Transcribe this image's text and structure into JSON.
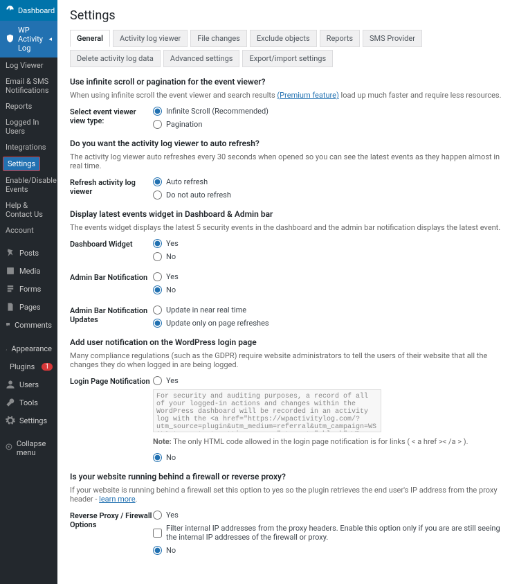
{
  "sidebar": {
    "dashboard": "Dashboard",
    "plugin": "WP Activity Log",
    "sub": [
      "Log Viewer",
      "Email & SMS Notifications",
      "Reports",
      "Logged In Users",
      "Integrations",
      "Settings",
      "Enable/Disable Events",
      "Help & Contact Us",
      "Account"
    ],
    "menu": [
      {
        "id": "posts",
        "label": "Posts",
        "icon": "pin"
      },
      {
        "id": "media",
        "label": "Media",
        "icon": "media"
      },
      {
        "id": "forms",
        "label": "Forms",
        "icon": "forms"
      },
      {
        "id": "pages",
        "label": "Pages",
        "icon": "page"
      },
      {
        "id": "comments",
        "label": "Comments",
        "icon": "comment"
      },
      {
        "id": "appearance",
        "label": "Appearance",
        "icon": "brush"
      },
      {
        "id": "plugins",
        "label": "Plugins",
        "icon": "plug",
        "badge": "1"
      },
      {
        "id": "users",
        "label": "Users",
        "icon": "user"
      },
      {
        "id": "tools",
        "label": "Tools",
        "icon": "tool"
      },
      {
        "id": "settings",
        "label": "Settings",
        "icon": "gear"
      }
    ],
    "collapse": "Collapse menu"
  },
  "page": {
    "title": "Settings",
    "tabs": [
      "General",
      "Activity log viewer",
      "File changes",
      "Exclude objects",
      "Reports",
      "SMS Provider",
      "Delete activity log data",
      "Advanced settings",
      "Export/import settings"
    ],
    "s1": {
      "h": "Use infinite scroll or pagination for the event viewer?",
      "d1": "When using infinite scroll the event viewer and search results ",
      "d_link": "(Premium feature)",
      "d2": " load up much faster and require less resources.",
      "lbl": "Select event viewer view type:",
      "o1": "Infinite Scroll (Recommended)",
      "o2": "Pagination"
    },
    "s2": {
      "h": "Do you want the activity log viewer to auto refresh?",
      "d": "The activity log viewer auto refreshes every 30 seconds when opened so you can see the latest events as they happen almost in real time.",
      "lbl": "Refresh activity log viewer",
      "o1": "Auto refresh",
      "o2": "Do not auto refresh"
    },
    "s3": {
      "h": "Display latest events widget in Dashboard & Admin bar",
      "d": "The events widget displays the latest 5 security events in the dashboard and the admin bar notification displays the latest event.",
      "lbl1": "Dashboard Widget",
      "lbl2": "Admin Bar Notification",
      "lbl3": "Admin Bar Notification Updates",
      "yes": "Yes",
      "no": "No",
      "u1": "Update in near real time",
      "u2": "Update only on page refreshes"
    },
    "s4": {
      "h": "Add user notification on the WordPress login page",
      "d": "Many compliance regulations (such as the GDPR) require website administrators to tell the users of their website that all the changes they do when logged in are being logged.",
      "lbl": "Login Page Notification",
      "txt": "For security and auditing purposes, a record of all of your logged-in actions and changes within the WordPress dashboard will be recorded in an activity log with the <a href=\"https://wpactivitylog.com/?utm_source=plugin&utm_medium=referral&utm_campaign=WSAL&utm_content=settings+pages\" target=\"_blank\">WP Activity Log",
      "note_pre": "Note:",
      "note": " The only HTML code allowed in the login page notification is for links ( < a href >< /a > )."
    },
    "s5": {
      "h": "Is your website running behind a firewall or reverse proxy?",
      "d": "If your website is running behind a firewall set this option to yes so the plugin retrieves the end user's IP address from the proxy header - ",
      "d_link": "learn more",
      "lbl": "Reverse Proxy / Firewall Options",
      "chk": "Filter internal IP addresses from the proxy headers. Enable this option only if you are are still seeing the internal IP addresses of the firewall or proxy."
    }
  }
}
